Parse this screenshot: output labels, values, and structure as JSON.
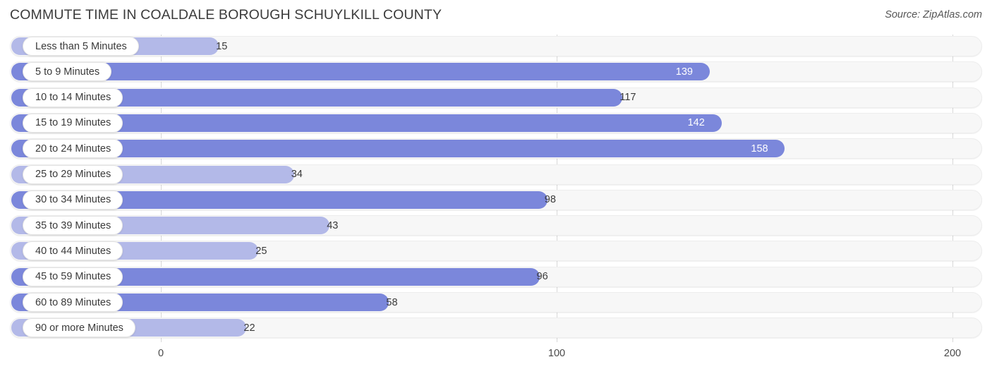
{
  "header": {
    "title": "COMMUTE TIME IN COALDALE BOROUGH SCHUYLKILL COUNTY",
    "source": "Source: ZipAtlas.com"
  },
  "chart_data": {
    "type": "bar",
    "orientation": "horizontal",
    "title": "COMMUTE TIME IN COALDALE BOROUGH SCHUYLKILL COUNTY",
    "subtitle": "",
    "xlabel": "",
    "ylabel": "",
    "xlim": [
      0,
      200
    ],
    "ticks": [
      "0",
      "100",
      "200"
    ],
    "tick_values": [
      0,
      100,
      200
    ],
    "grid": true,
    "legend": false,
    "categories": [
      "Less than 5 Minutes",
      "5 to 9 Minutes",
      "10 to 14 Minutes",
      "15 to 19 Minutes",
      "20 to 24 Minutes",
      "25 to 29 Minutes",
      "30 to 34 Minutes",
      "35 to 39 Minutes",
      "40 to 44 Minutes",
      "45 to 59 Minutes",
      "60 to 89 Minutes",
      "90 or more Minutes"
    ],
    "values": [
      15,
      139,
      117,
      142,
      158,
      34,
      98,
      43,
      25,
      96,
      58,
      22
    ],
    "value_labels": [
      "15",
      "139",
      "117",
      "142",
      "158",
      "34",
      "98",
      "43",
      "25",
      "96",
      "58",
      "22"
    ],
    "colors": {
      "bar_strong": "#7b87db",
      "bar_light": "#b3b9e8",
      "track": "#f7f7f7",
      "gridline": "#d8d8d8",
      "label_text": "#3a3a3a",
      "inbar_text": "#ffffff"
    }
  }
}
